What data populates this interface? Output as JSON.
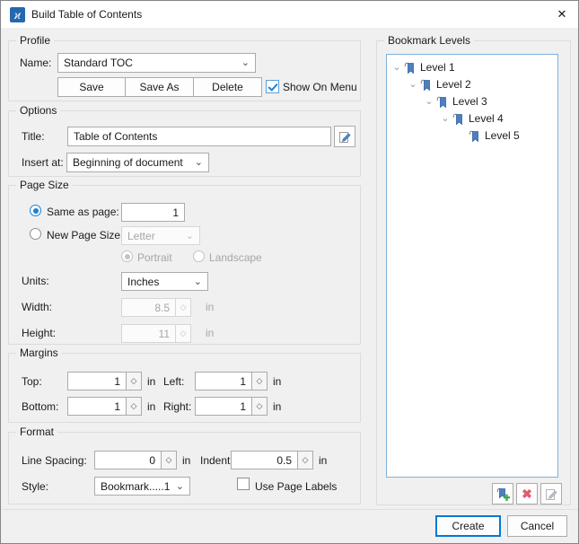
{
  "window": {
    "title": "Build Table of Contents"
  },
  "icons": {
    "close": "✕",
    "dropdown_chevron": "⌄",
    "spinner": "◇",
    "tree_expand": "⌄",
    "delete_x": "✖",
    "app_logo_glyph": "ϰ"
  },
  "profile": {
    "legend": "Profile",
    "name_label": "Name:",
    "name_value": "Standard TOC",
    "save_label": "Save",
    "save_as_label": "Save As",
    "delete_label": "Delete",
    "show_on_menu_label": "Show On Menu",
    "show_on_menu_checked": true
  },
  "options": {
    "legend": "Options",
    "title_label": "Title:",
    "title_value": "Table of Contents",
    "insert_label": "Insert at:",
    "insert_value": "Beginning of document"
  },
  "page_size": {
    "legend": "Page Size",
    "same_as_page_label": "Same as page:",
    "same_as_page_value": "1",
    "new_page_size_label": "New Page Size:",
    "new_page_size_value": "Letter",
    "portrait_label": "Portrait",
    "landscape_label": "Landscape",
    "units_label": "Units:",
    "units_value": "Inches",
    "width_label": "Width:",
    "width_value": "8.5",
    "width_unit": "in",
    "height_label": "Height:",
    "height_value": "11",
    "height_unit": "in"
  },
  "margins": {
    "legend": "Margins",
    "top_label": "Top:",
    "top_value": "1",
    "bottom_label": "Bottom:",
    "bottom_value": "1",
    "left_label": "Left:",
    "left_value": "1",
    "right_label": "Right:",
    "right_value": "1",
    "unit": "in"
  },
  "format": {
    "legend": "Format",
    "line_spacing_label": "Line Spacing:",
    "line_spacing_value": "0",
    "indent_label": "Indent:",
    "indent_value": "0.5",
    "style_label": "Style:",
    "style_value": "Bookmark.....1",
    "use_page_labels_label": "Use Page Labels",
    "use_page_labels_checked": false,
    "unit": "in"
  },
  "bookmark_levels": {
    "legend": "Bookmark Levels",
    "items": [
      {
        "label": "Level 1",
        "indent": 0,
        "expandable": true
      },
      {
        "label": "Level 2",
        "indent": 1,
        "expandable": true
      },
      {
        "label": "Level 3",
        "indent": 2,
        "expandable": true
      },
      {
        "label": "Level 4",
        "indent": 3,
        "expandable": true
      },
      {
        "label": "Level 5",
        "indent": 4,
        "expandable": false
      }
    ]
  },
  "footer": {
    "create_label": "Create",
    "cancel_label": "Cancel"
  },
  "colors": {
    "accent": "#0078d7",
    "check_blue": "#1883d7",
    "tree_border": "#7fb2dc",
    "delete_red": "#e05c70",
    "bookmark_blue": "#4c80c0",
    "add_green": "#3fae49"
  }
}
